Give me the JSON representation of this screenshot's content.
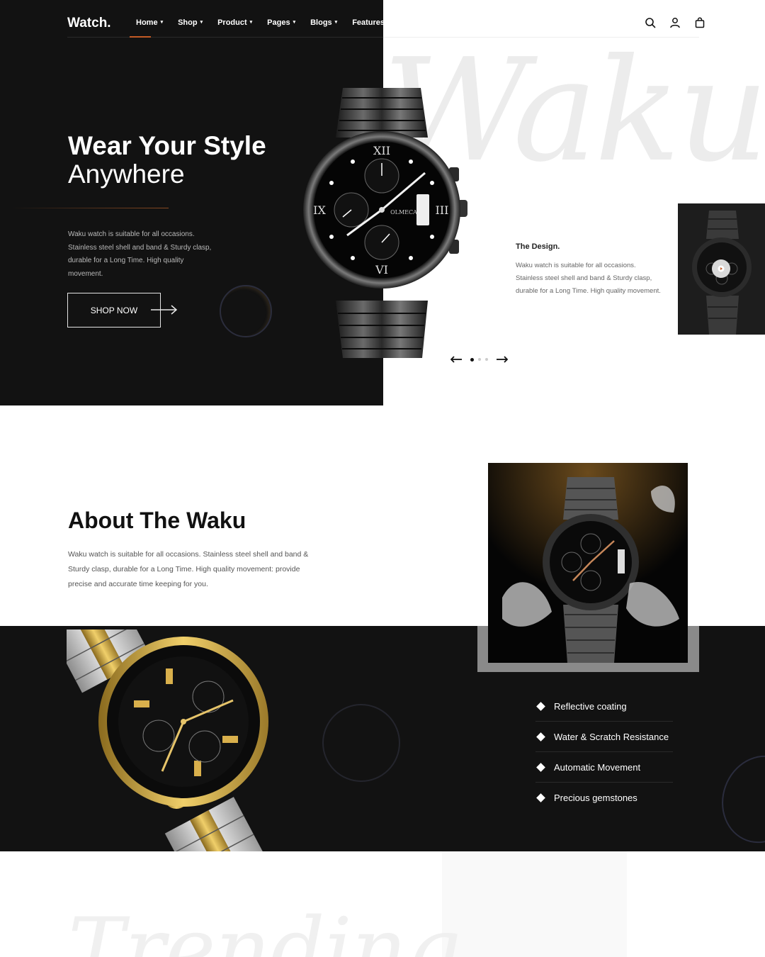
{
  "header": {
    "logo": "Watch.",
    "nav": [
      {
        "label": "Home"
      },
      {
        "label": "Shop"
      },
      {
        "label": "Product"
      },
      {
        "label": "Pages"
      },
      {
        "label": "Blogs"
      },
      {
        "label": "Features"
      }
    ],
    "icons": [
      "search-icon",
      "user-icon",
      "bag-icon"
    ]
  },
  "hero": {
    "watermark": "Waku",
    "title_bold": "Wear Your Style",
    "title_light": "Anywhere",
    "description": "Waku watch is suitable for all occasions. Stainless steel shell and band & Sturdy clasp, durable for a Long Time. High quality movement.",
    "cta": "SHOP NOW",
    "watch_brand": "OLMECA",
    "slide_count": 3,
    "active_slide": 1
  },
  "design": {
    "title": "The Design.",
    "description": "Waku watch is suitable for all occasions. Stainless steel shell and band & Sturdy clasp, durable for a Long Time. High quality movement."
  },
  "about": {
    "title_bold": "About The",
    "title_light": "Waku",
    "description": "Waku watch is suitable for all occasions. Stainless steel shell and band & Sturdy clasp, durable for a Long Time. High quality movement: provide precise and accurate time keeping for you.",
    "features": [
      "Reflective coating",
      "Water & Scratch Resistance",
      "Automatic Movement",
      "Precious gemstones"
    ]
  },
  "trending": {
    "watermark": "Trending"
  },
  "colors": {
    "dark": "#121212",
    "accent": "#c35a25",
    "light_bg": "#ffffff"
  }
}
